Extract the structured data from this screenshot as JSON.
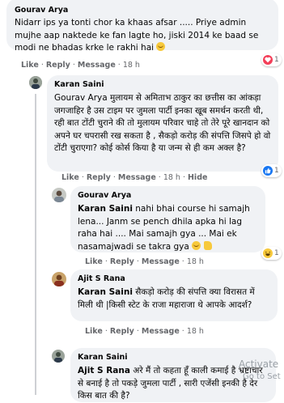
{
  "comments": [
    {
      "author": "Gourav Arya",
      "text": "Nidarr ips ya tonti chor ka khaas afsar ..... Priye admin mujhe aap naktede ke fan lagte ho, jiski 2014 ke baad se modi ne bhadas krke le rakhi hai",
      "actions": {
        "like": "Like",
        "reply": "Reply",
        "message": "Message",
        "time": "18 h"
      },
      "reactions": {
        "icons": [
          "heart-icon"
        ],
        "count": "1"
      }
    },
    {
      "author": "Karan Saini",
      "text": "Gourav Arya मुलायम से अमिताभ ठाकुर का छत्तीस का आंकड़ा जगजाहिर है उस टाइम पर जुमला पार्टी इनका खूब समर्थन करती थी, रही बात टोंटी चुराने की तो मुलायम परिवार चाहे तो तेरे पूरे खानदान को अपने घर चपरासी रख सकता है , सैकड़ो करोड़ की संपत्ति जिसपे हो वो टोंटी चुराएगा? कोई कोर्स किया है या जन्म से ही कम अक्ल है?",
      "actions": {
        "like": "Like",
        "reply": "Reply",
        "message": "Message",
        "time": "18 h",
        "hide": "Hide"
      },
      "reactions": {
        "icons": [
          "like-icon"
        ],
        "count": "1"
      }
    },
    {
      "author": "Gourav Arya",
      "tag": "Karan Saini",
      "text": "nahi bhai course hi samajh lena... Janm se pench dhila apka hi lag raha hai .... Mai samajh gya ... Mai ek nasamajwadi se takra gya",
      "actions": {
        "like": "Like",
        "reply": "Reply",
        "message": "Message",
        "time": "18 h"
      },
      "reactions": {
        "icons": [
          "haha-icon"
        ],
        "count": "1"
      }
    },
    {
      "author": "Ajit S Rana",
      "tag": "Karan Saini",
      "text": "सैकड़ो करोड़ की संपत्ति क्या विरासत में मिली थी |किसी स्टेट के राजा महाराजा थे आपके आदर्श?",
      "actions": {
        "like": "Like",
        "reply": "Reply",
        "message": "Message",
        "time": "18 h"
      }
    },
    {
      "author": "Karan Saini",
      "tag": "Ajit S Rana",
      "text": "अरे मैं तो कहता हूँ काली कमाई है भ्रष्टाचार से बनाई है तो पकड़े जुमला पार्टी , सारी एजेंसी इनकी है देर किस बात की है?"
    }
  ],
  "watermark": {
    "line1": "Activate",
    "line2": "Go to Set"
  }
}
